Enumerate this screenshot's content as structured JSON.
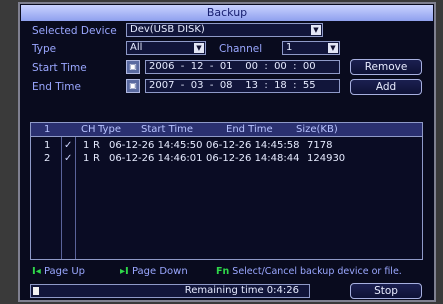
{
  "window": {
    "title": "Backup"
  },
  "selected_device": {
    "label": "Selected Device",
    "value": "Dev(USB DISK)"
  },
  "type": {
    "label": "Type",
    "value": "All"
  },
  "channel": {
    "label": "Channel",
    "value": "1"
  },
  "start_time": {
    "label": "Start Time",
    "value": "2006  -  12  -  01    00  :  00  :  00"
  },
  "end_time": {
    "label": "End Time",
    "value": "2007  -  03  -  08    13  :  18  :  55"
  },
  "buttons": {
    "remove": "Remove",
    "add": "Add",
    "stop": "Stop"
  },
  "table": {
    "headers": {
      "index": "1",
      "ch": "CH",
      "type": "Type",
      "start": "Start Time",
      "end": "End Time",
      "size": "Size(KB)"
    },
    "rows": [
      {
        "index": "1",
        "checked": "✓",
        "ch": "1",
        "type": "R",
        "start": "06-12-26 14:45:50",
        "end": "06-12-26 14:45:58",
        "size": "7178"
      },
      {
        "index": "2",
        "checked": "✓",
        "ch": "1",
        "type": "R",
        "start": "06-12-26 14:46:01",
        "end": "06-12-26 14:48:44",
        "size": "124930"
      }
    ]
  },
  "legend": {
    "page_up_key": "I◂",
    "page_up": "Page Up",
    "page_down_key": "▸I",
    "page_down": "Page Down",
    "select_key": "Fn",
    "select": "Select/Cancel backup device or file."
  },
  "progress": {
    "remaining_label": "Remaining time 0:4:26",
    "fraction": 0.02
  },
  "icons": {
    "calendar": "calendar-icon",
    "dropdown": "chevron-down-icon",
    "check": "check-icon"
  }
}
